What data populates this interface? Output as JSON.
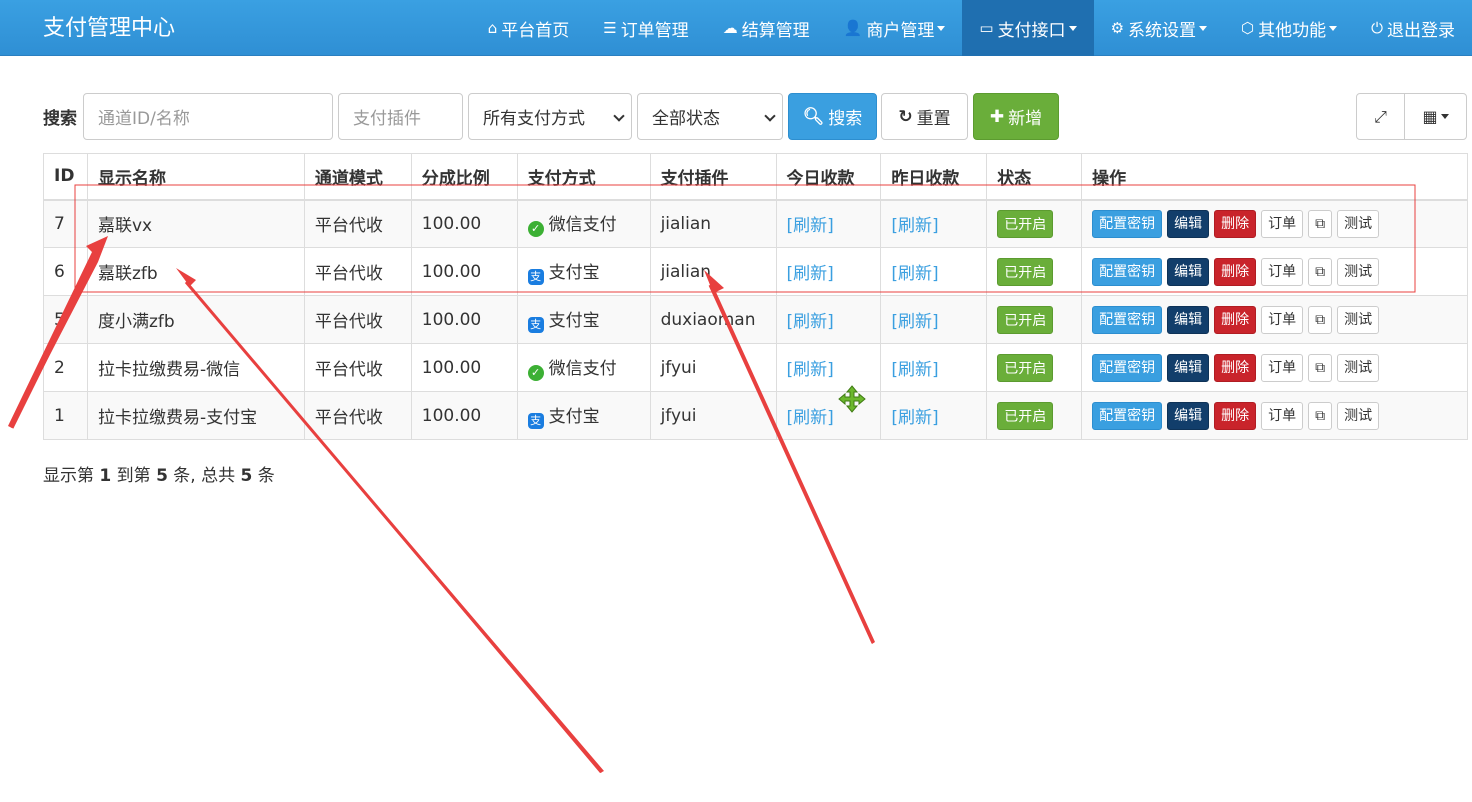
{
  "brand": "支付管理中心",
  "nav": [
    {
      "icon": "home-icon",
      "glyph": "⌂",
      "label": "平台首页",
      "dropdown": false,
      "active": false
    },
    {
      "icon": "list-icon",
      "glyph": "☰",
      "label": "订单管理",
      "dropdown": false,
      "active": false
    },
    {
      "icon": "cloud-icon",
      "glyph": "☁",
      "label": "结算管理",
      "dropdown": false,
      "active": false
    },
    {
      "icon": "user-icon",
      "glyph": "👤",
      "label": "商户管理",
      "dropdown": true,
      "active": false
    },
    {
      "icon": "credit-card-icon",
      "glyph": "▭",
      "label": "支付接口",
      "dropdown": true,
      "active": true
    },
    {
      "icon": "gear-icon",
      "glyph": "⚙",
      "label": "系统设置",
      "dropdown": true,
      "active": false
    },
    {
      "icon": "cube-icon",
      "glyph": "⬡",
      "label": "其他功能",
      "dropdown": true,
      "active": false
    },
    {
      "icon": "power-icon",
      "glyph": "⏻",
      "label": "退出登录",
      "dropdown": false,
      "active": false
    }
  ],
  "search": {
    "label": "搜索",
    "id_placeholder": "通道ID/名称",
    "plugin_placeholder": "支付插件",
    "pay_method_value": "所有支付方式",
    "status_value": "全部状态",
    "search_button": "搜索",
    "reset_button": "重置",
    "add_button": "新增"
  },
  "table": {
    "headers": [
      "ID",
      "显示名称",
      "通道模式",
      "分成比例",
      "支付方式",
      "支付插件",
      "今日收款",
      "昨日收款",
      "状态",
      "操作"
    ],
    "rows": [
      {
        "id": "7",
        "name": "嘉联vx",
        "mode": "平台代收",
        "ratio": "100.00",
        "pay_type": "wx",
        "pay": "微信支付",
        "plugin": "jialian",
        "today": "[刷新]",
        "yesterday": "[刷新]",
        "status": "已开启"
      },
      {
        "id": "6",
        "name": "嘉联zfb",
        "mode": "平台代收",
        "ratio": "100.00",
        "pay_type": "ali",
        "pay": "支付宝",
        "plugin": "jialian",
        "today": "[刷新]",
        "yesterday": "[刷新]",
        "status": "已开启"
      },
      {
        "id": "5",
        "name": "度小满zfb",
        "mode": "平台代收",
        "ratio": "100.00",
        "pay_type": "ali",
        "pay": "支付宝",
        "plugin": "duxiaoman",
        "today": "[刷新]",
        "yesterday": "[刷新]",
        "status": "已开启"
      },
      {
        "id": "2",
        "name": "拉卡拉缴费易-微信",
        "mode": "平台代收",
        "ratio": "100.00",
        "pay_type": "wx",
        "pay": "微信支付",
        "plugin": "jfyui",
        "today": "[刷新]",
        "yesterday": "[刷新]",
        "status": "已开启"
      },
      {
        "id": "1",
        "name": "拉卡拉缴费易-支付宝",
        "mode": "平台代收",
        "ratio": "100.00",
        "pay_type": "ali",
        "pay": "支付宝",
        "plugin": "jfyui",
        "today": "[刷新]",
        "yesterday": "[刷新]",
        "status": "已开启"
      }
    ],
    "ops": {
      "config": "配置密钥",
      "edit": "编辑",
      "delete": "删除",
      "orders": "订单",
      "copy": "⧉",
      "test": "测试"
    }
  },
  "footer": {
    "prefix": "显示第 ",
    "from": "1",
    "mid": " 到第 ",
    "to": "5",
    "mid2": " 条, 总共 ",
    "total": "5",
    "suffix": " 条"
  },
  "colors": {
    "nav_bg": "#3aa0e2",
    "nav_active": "#1f6fb0",
    "annotation": "#e8403f"
  }
}
